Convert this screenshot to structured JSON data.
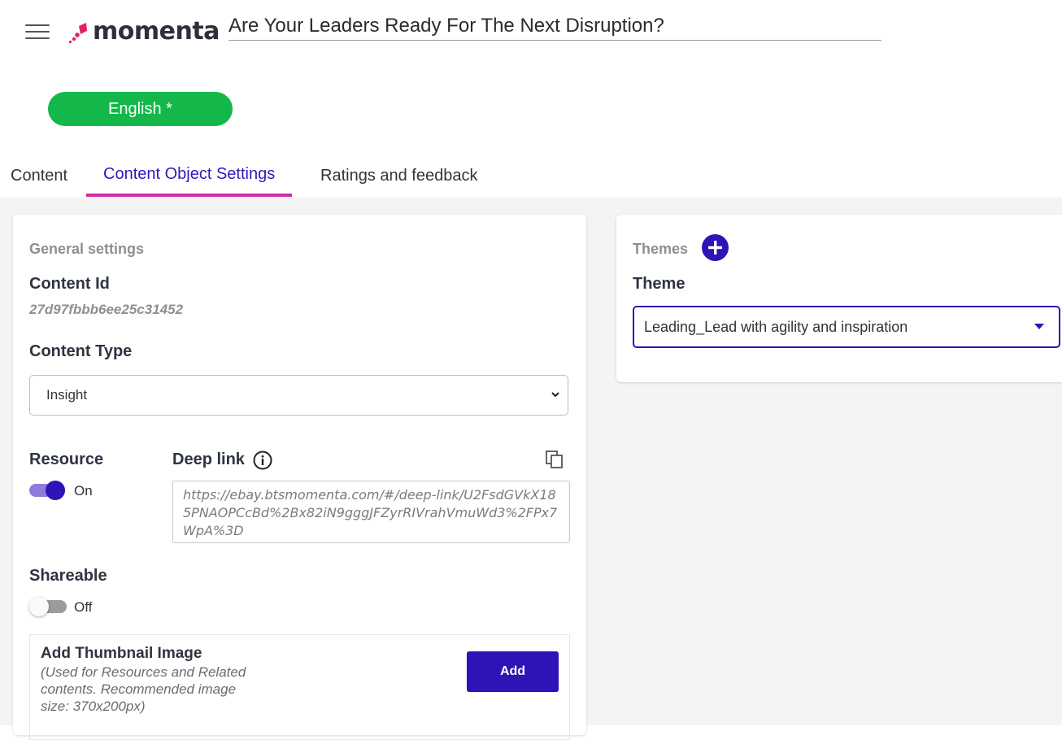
{
  "header": {
    "logo_text": "momenta",
    "title_value": "Are Your Leaders Ready For The Next Disruption?"
  },
  "language": {
    "label": "English *"
  },
  "tabs": [
    {
      "label": "Content",
      "active": false
    },
    {
      "label": "Content Object Settings",
      "active": true
    },
    {
      "label": "Ratings and feedback",
      "active": false
    }
  ],
  "general": {
    "section_title": "General settings",
    "content_id_label": "Content Id",
    "content_id_value": "27d97fbbb6ee25c31452",
    "content_type_label": "Content Type",
    "content_type_value": "Insight",
    "resource_label": "Resource",
    "resource_state": "On",
    "deep_link_label": "Deep link",
    "deep_link_value": "https://ebay.btsmomenta.com/#/deep-link/U2FsdGVkX185PNAOPCcBd%2Bx82iN9gggJFZyrRIVrahVmuWd3%2FPx7WpA%3D",
    "shareable_label": "Shareable",
    "shareable_state": "Off",
    "thumbnail_title": "Add Thumbnail Image",
    "thumbnail_note": "(Used for Resources and Related contents. Recommended image size: 370x200px)",
    "add_button_label": "Add"
  },
  "themes": {
    "section_title": "Themes",
    "theme_label": "Theme",
    "theme_value": "Leading_Lead with agility and inspiration"
  },
  "colors": {
    "primary": "#2e13b6",
    "tab_underline": "#d12ca8",
    "language_pill": "#14b84a",
    "logo_accent": "#e0245e"
  }
}
